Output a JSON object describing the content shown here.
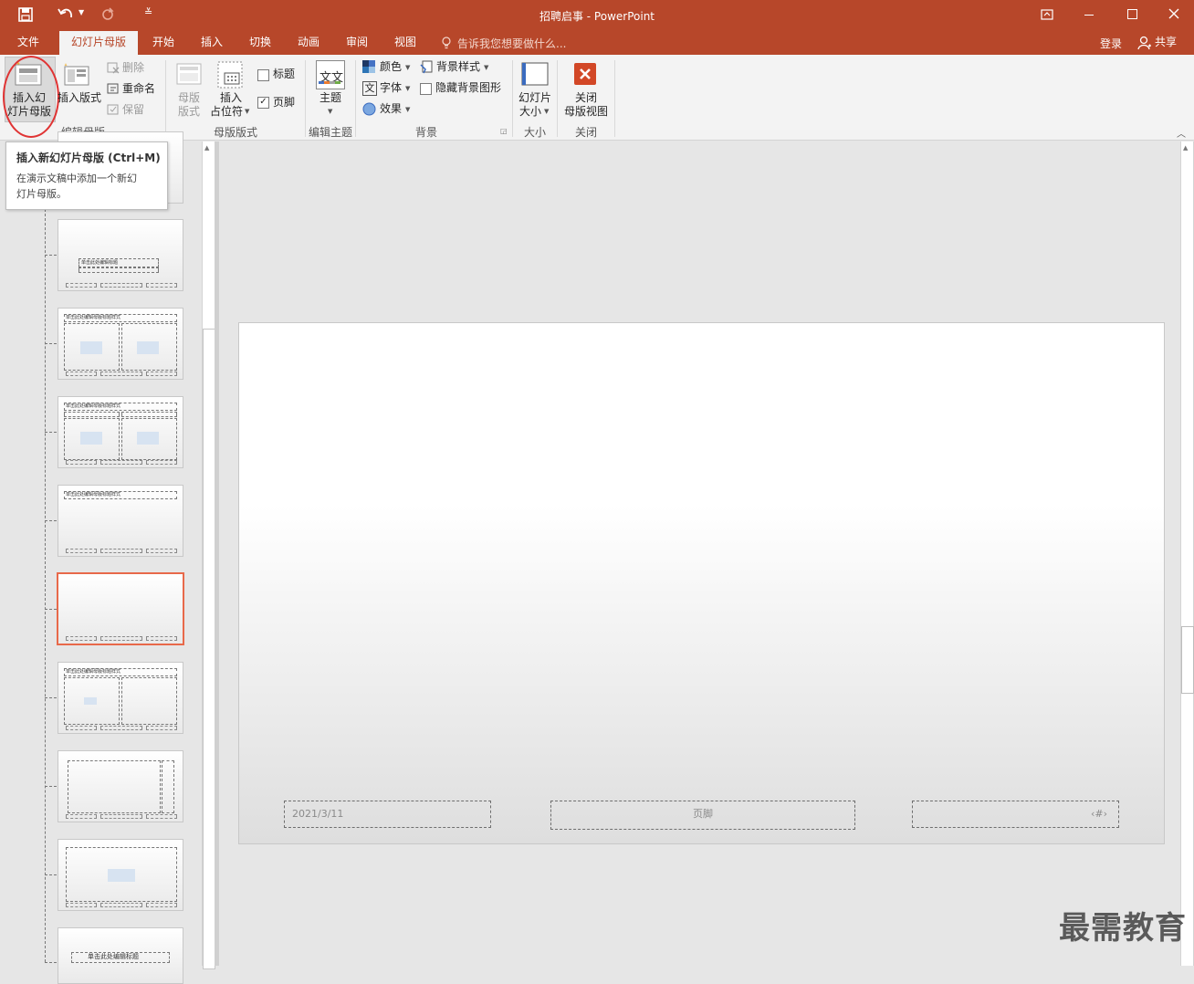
{
  "window": {
    "title": "招聘启事 - PowerPoint",
    "accent": "#b7472a"
  },
  "tabs": [
    {
      "label": "文件"
    },
    {
      "label": "幻灯片母版",
      "active": true
    },
    {
      "label": "开始"
    },
    {
      "label": "插入"
    },
    {
      "label": "切换"
    },
    {
      "label": "动画"
    },
    {
      "label": "审阅"
    },
    {
      "label": "视图"
    }
  ],
  "tell_me": "告诉我您想要做什么...",
  "account": {
    "signin": "登录",
    "share": "共享"
  },
  "ribbon": {
    "insert_master": [
      "插入幻",
      "灯片母版"
    ],
    "insert_layout": "插入版式",
    "delete": "删除",
    "rename": "重命名",
    "preserve": "保留",
    "group_edit_master": "编辑母版",
    "master_layout": [
      "母版",
      "版式"
    ],
    "insert_placeholder": [
      "插入",
      "占位符"
    ],
    "title_chk": "标题",
    "footer_chk": "页脚",
    "group_master_layout": "母版版式",
    "theme": "主题",
    "theme_icon_text": "文文",
    "group_edit_theme": "编辑主题",
    "colors": "颜色",
    "fonts": "字体",
    "effects": "效果",
    "bg_styles": "背景样式",
    "hide_bg": "隐藏背景图形",
    "group_background": "背景",
    "slide_size": [
      "幻灯片",
      "大小"
    ],
    "group_size": "大小",
    "close_master": [
      "关闭",
      "母版视图"
    ],
    "group_close": "关闭"
  },
  "tooltip": {
    "title": "插入新幻灯片母版 (Ctrl+M)",
    "body_line1": "在演示文稿中添加一个新幻",
    "body_line2": "灯片母版。"
  },
  "thumbnails": {
    "t1_title": "单击此处编辑标题",
    "t2_title": "单击此处编辑母版标题样式",
    "last_title": "单击此处编辑标题"
  },
  "slide": {
    "date": "2021/3/11",
    "footer": "页脚",
    "number": "‹#›"
  },
  "watermark": "最需教育"
}
